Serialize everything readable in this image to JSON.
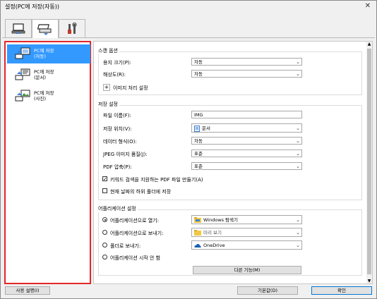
{
  "window": {
    "title": "설정(PC에 저장(자동))"
  },
  "tabs": [
    {
      "icon": "computer-scan-icon",
      "active": false
    },
    {
      "icon": "scanner-icon",
      "active": true
    },
    {
      "icon": "tools-icon",
      "active": false
    }
  ],
  "modes": [
    {
      "label": "PC에 저장\n(자동)",
      "selected": true
    },
    {
      "label": "PC에 저장\n(문서)",
      "selected": false
    },
    {
      "label": "PC에 저장\n(사진)",
      "selected": false
    }
  ],
  "scan_options": {
    "title": "스캔 옵션",
    "paper_size_label": "용지 크기(P):",
    "paper_size_value": "자동",
    "resolution_label": "해상도(R):",
    "resolution_value": "자동",
    "image_processing_label": "이미지 처리 설정"
  },
  "save_settings": {
    "title": "저장 설정",
    "file_name_label": "파일 이름(F):",
    "file_name_value": "IMG",
    "save_location_label": "저장 위치(V):",
    "save_location_value": "문서",
    "data_format_label": "데이터 형식(O):",
    "data_format_value": "자동",
    "jpeg_quality_label": "JPEG 이미지 품질(J):",
    "jpeg_quality_value": "표준",
    "pdf_compression_label": "PDF 압축(P):",
    "pdf_compression_value": "표준",
    "keyword_pdf_label": "키워드 검색을 지원하는 PDF 파일 만들기(A)",
    "keyword_pdf_checked": true,
    "date_subfolder_label": "현재 날짜의 하위 폴더에 저장",
    "date_subfolder_checked": false
  },
  "app_settings": {
    "title": "어플리케이션 설정",
    "open_app_label": "어플리케이션으로 열기:",
    "open_app_value": "Windows 탐색기",
    "send_app_label": "어플리케이션으로 보내기:",
    "send_app_value": "미리 보기",
    "send_folder_label": "폴더로 보내기:",
    "send_folder_value": "OneDrive",
    "no_app_label": "어플리케이션 시작 안 함",
    "selected_option": "open_app",
    "more_functions_label": "다른 기능(M)"
  },
  "footer": {
    "instructions_label": "사용 설명(I)",
    "defaults_label": "기본값(D)",
    "ok_label": "확인"
  }
}
